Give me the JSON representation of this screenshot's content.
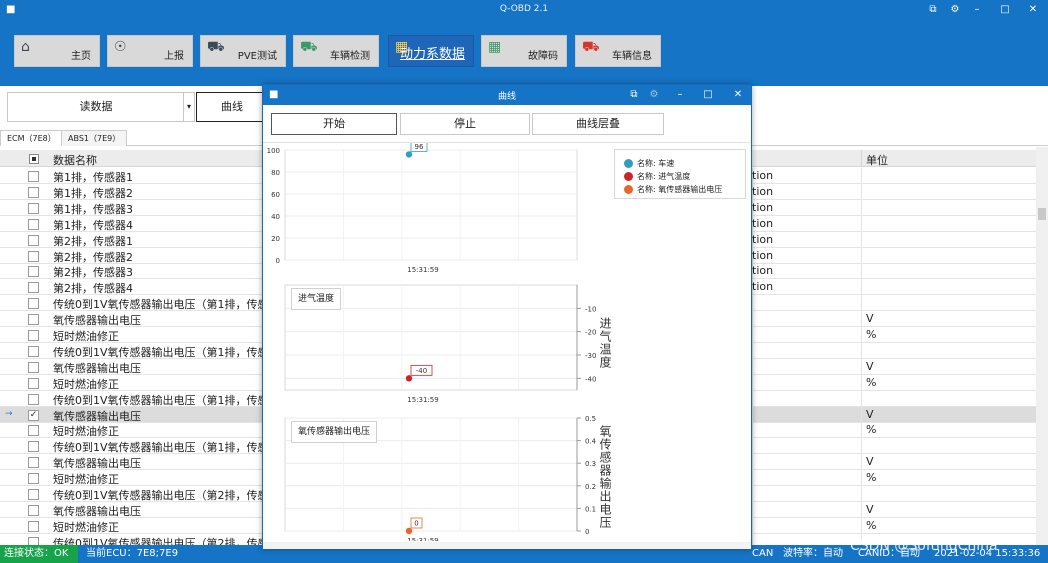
{
  "app": {
    "title": "Q-OBD 2.1"
  },
  "toolbar": {
    "buttons": [
      {
        "key": "home",
        "label": "主页",
        "icon": "home-icon"
      },
      {
        "key": "report",
        "label": "上报",
        "icon": "globe-icon"
      },
      {
        "key": "pve",
        "label": "PVE测试",
        "icon": "truck-icon"
      },
      {
        "key": "inspect",
        "label": "车辆检测",
        "icon": "car-icon"
      },
      {
        "key": "power",
        "label": "动力系数据",
        "icon": "grid-icon"
      },
      {
        "key": "dtc",
        "label": "故障码",
        "icon": "grid-x-icon"
      },
      {
        "key": "info",
        "label": "车辆信息",
        "icon": "car-red-icon"
      }
    ]
  },
  "sub": {
    "read_label": "读数据",
    "curve_label": "曲线"
  },
  "ecu_tabs": [
    "ECM（7E8）",
    "ABS1（7E9）"
  ],
  "table": {
    "header": {
      "name": "数据名称",
      "unit": "单位"
    },
    "rows": [
      {
        "name": "第1排，传感器1",
        "extra": "tion",
        "unit": "",
        "checked": false
      },
      {
        "name": "第1排，传感器2",
        "extra": "tion",
        "unit": "",
        "checked": false
      },
      {
        "name": "第1排，传感器3",
        "extra": "tion",
        "unit": "",
        "checked": false
      },
      {
        "name": "第1排，传感器4",
        "extra": "tion",
        "unit": "",
        "checked": false
      },
      {
        "name": "第2排，传感器1",
        "extra": "tion",
        "unit": "",
        "checked": false
      },
      {
        "name": "第2排，传感器2",
        "extra": "tion",
        "unit": "",
        "checked": false
      },
      {
        "name": "第2排，传感器3",
        "extra": "tion",
        "unit": "",
        "checked": false
      },
      {
        "name": "第2排，传感器4",
        "extra": "tion",
        "unit": "",
        "checked": false
      },
      {
        "name": "传统0到1V氧传感器输出电压（第1排，传感",
        "extra": "",
        "unit": "",
        "checked": false
      },
      {
        "name": "氧传感器输出电压",
        "extra": "",
        "unit": "V",
        "checked": false
      },
      {
        "name": "短时燃油修正",
        "extra": "",
        "unit": "%",
        "checked": false
      },
      {
        "name": "传统0到1V氧传感器输出电压（第1排，传感",
        "extra": "",
        "unit": "",
        "checked": false
      },
      {
        "name": "氧传感器输出电压",
        "extra": "",
        "unit": "V",
        "checked": false
      },
      {
        "name": "短时燃油修正",
        "extra": "",
        "unit": "%",
        "checked": false
      },
      {
        "name": "传统0到1V氧传感器输出电压（第1排，传感",
        "extra": "",
        "unit": "",
        "checked": false
      },
      {
        "name": "氧传感器输出电压",
        "extra": "",
        "unit": "V",
        "checked": true
      },
      {
        "name": "短时燃油修正",
        "extra": "",
        "unit": "%",
        "checked": false
      },
      {
        "name": "传统0到1V氧传感器输出电压（第1排，传感",
        "extra": "",
        "unit": "",
        "checked": false
      },
      {
        "name": "氧传感器输出电压",
        "extra": "",
        "unit": "V",
        "checked": false
      },
      {
        "name": "短时燃油修正",
        "extra": "",
        "unit": "%",
        "checked": false
      },
      {
        "name": "传统0到1V氧传感器输出电压（第2排，传感",
        "extra": "",
        "unit": "",
        "checked": false
      },
      {
        "name": "氧传感器输出电压",
        "extra": "",
        "unit": "V",
        "checked": false
      },
      {
        "name": "短时燃油修正",
        "extra": "",
        "unit": "%",
        "checked": false
      },
      {
        "name": "传统0到1V氧传感器输出电压（第2排，传感",
        "extra": "",
        "unit": "",
        "checked": false
      }
    ]
  },
  "status": {
    "conn": "连接状态：OK",
    "ecu": "当前ECU：7E8;7E9",
    "can": "CAN",
    "baud": "波特率：自动",
    "canid": "CANID：自动",
    "datetime": "2021-02-04  15:33:36",
    "watermark": "CSDN @SoftingChina"
  },
  "dialog": {
    "title": "曲线",
    "buttons": {
      "start": "开始",
      "stop": "停止",
      "overlay": "曲线层叠"
    }
  },
  "chart_data": [
    {
      "type": "scatter",
      "name": "车速",
      "color": "#2f9ec1",
      "x": [
        "15:31:59"
      ],
      "values": [
        96
      ],
      "value_label": "96",
      "yticks": [
        "100",
        "80",
        "60",
        "40",
        "20",
        "0"
      ],
      "ylim": [
        0,
        100
      ],
      "xlabel": "15:31:59"
    },
    {
      "type": "scatter",
      "name": "进气温度",
      "color": "#c9252c",
      "x": [
        "15:31:59"
      ],
      "values": [
        -40
      ],
      "value_label": "-40",
      "yticks": [
        "-10",
        "-20",
        "-30",
        "-40"
      ],
      "ylim": [
        -45,
        0
      ],
      "xlabel": "15:31:59",
      "box_label": "进气温度",
      "ylabel": "进气温度"
    },
    {
      "type": "scatter",
      "name": "氧传感器输出电压",
      "color": "#e8662c",
      "x": [
        "15:31:59"
      ],
      "values": [
        0
      ],
      "value_label": "0",
      "yticks": [
        "0.5",
        "0.4",
        "0.3",
        "0.2",
        "0.1",
        "0"
      ],
      "ylim": [
        0,
        0.5
      ],
      "xlabel": "15:31:59",
      "box_label": "氧传感器输出电压",
      "ylabel": "氧传感器输出电压"
    }
  ],
  "legend": {
    "items": [
      {
        "label": "名称: 车速",
        "color": "#2f9ec1"
      },
      {
        "label": "名称: 进气温度",
        "color": "#c9252c"
      },
      {
        "label": "名称: 氧传感器输出电压",
        "color": "#e8662c"
      }
    ]
  }
}
